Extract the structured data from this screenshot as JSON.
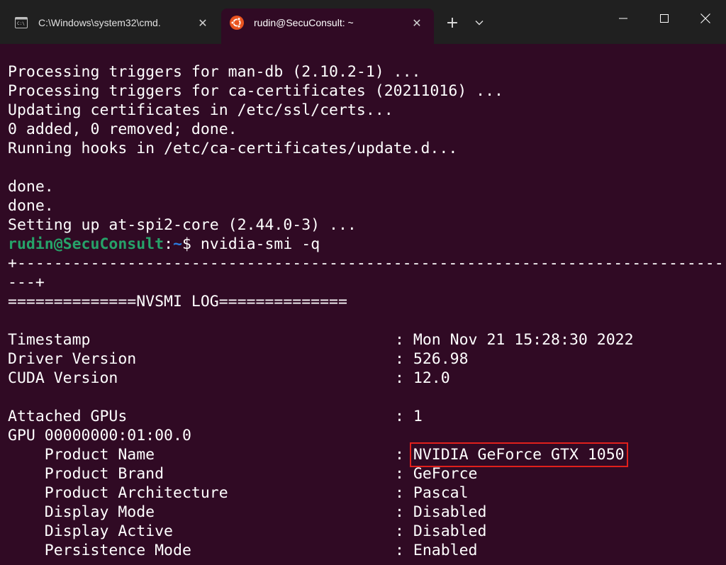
{
  "tabs": [
    {
      "title": "C:\\Windows\\system32\\cmd.",
      "icon": "cmd-icon",
      "active": false
    },
    {
      "title": "rudin@SecuConsult: ~",
      "icon": "ubuntu-icon",
      "active": true
    }
  ],
  "toolbar": {
    "new_tab": "+",
    "close_glyph": "✕"
  },
  "colors": {
    "terminal_bg": "#300a24",
    "titlebar_bg": "#202020",
    "prompt_user": "#26a269",
    "prompt_path": "#2a7bde",
    "highlight_box": "#e0201c",
    "ubuntu_orange": "#e95420"
  },
  "terminal": {
    "output_lines": [
      "Processing triggers for man-db (2.10.2-1) ...",
      "Processing triggers for ca-certificates (20211016) ...",
      "Updating certificates in /etc/ssl/certs...",
      "0 added, 0 removed; done.",
      "Running hooks in /etc/ca-certificates/update.d...",
      "",
      "done.",
      "done.",
      "Setting up at-spi2-core (2.44.0-3) ..."
    ],
    "prompt": {
      "user_host": "rudin@SecuConsult",
      "colon": ":",
      "path": "~",
      "dollar": "$",
      "command": " nvidia-smi -q"
    },
    "border_top": "+-----------------------------------------------------------------------------",
    "border_wrap": "---+",
    "log_header": "==============NVSMI LOG==============",
    "info": [
      {
        "key": "Timestamp",
        "value": "Mon Nov 21 15:28:30 2022"
      },
      {
        "key": "Driver Version",
        "value": "526.98"
      },
      {
        "key": "CUDA Version",
        "value": "12.0"
      }
    ],
    "attached": {
      "key": "Attached GPUs",
      "value": "1"
    },
    "gpu_id": "GPU 00000000:01:00.0",
    "gpu_props": [
      {
        "key": "    Product Name",
        "value": "NVIDIA GeForce GTX 1050"
      },
      {
        "key": "    Product Brand",
        "value": "GeForce"
      },
      {
        "key": "    Product Architecture",
        "value": "Pascal"
      },
      {
        "key": "    Display Mode",
        "value": "Disabled"
      },
      {
        "key": "    Display Active",
        "value": "Disabled"
      },
      {
        "key": "    Persistence Mode",
        "value": "Enabled"
      }
    ],
    "separator": ": "
  }
}
